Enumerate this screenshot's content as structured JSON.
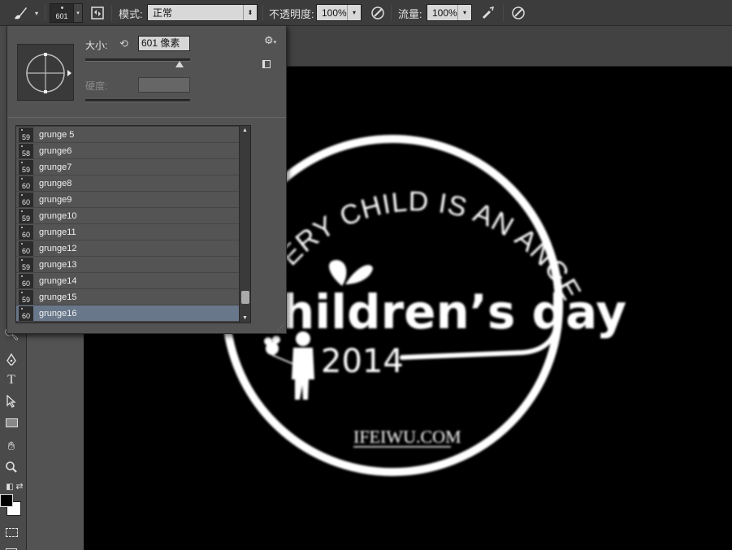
{
  "options_bar": {
    "brush_size": "601",
    "mode_label": "模式:",
    "mode_value": "正常",
    "opacity_label": "不透明度:",
    "opacity_value": "100%",
    "flow_label": "流量:",
    "flow_value": "100%"
  },
  "brush_panel": {
    "size_label": "大小:",
    "size_value": "601 像素",
    "hardness_label": "硬度:",
    "size_slider_fraction": 0.9,
    "brushes": [
      {
        "size": "59",
        "name": "grunge 5"
      },
      {
        "size": "58",
        "name": "grunge6"
      },
      {
        "size": "59",
        "name": "grunge7"
      },
      {
        "size": "60",
        "name": "grunge8"
      },
      {
        "size": "60",
        "name": "grunge9"
      },
      {
        "size": "59",
        "name": "grunge10"
      },
      {
        "size": "60",
        "name": "grunge11"
      },
      {
        "size": "60",
        "name": "grunge12"
      },
      {
        "size": "59",
        "name": "grunge13"
      },
      {
        "size": "60",
        "name": "grunge14"
      },
      {
        "size": "59",
        "name": "grunge15"
      },
      {
        "size": "60",
        "name": "grunge16"
      }
    ],
    "selected_brush": "grunge16"
  },
  "artwork": {
    "arc_text": "EVERY CHILD IS AN ANGEL",
    "title_text": "hildren’s day",
    "year_text": "2014",
    "site_text": "IFEIWU.COM"
  },
  "colors": {
    "accent_selection": "#68778a",
    "canvas_background": "#000000",
    "artwork_white": "#ffffff"
  }
}
